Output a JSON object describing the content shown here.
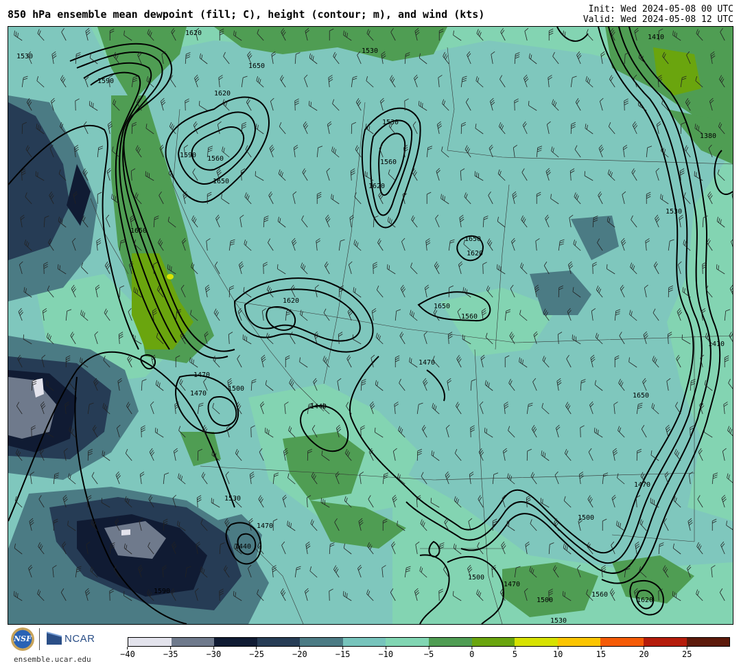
{
  "header": {
    "title": "850 hPa ensemble mean dewpoint (fill; C), height (contour; m), and wind (kts)",
    "init": "Init: Wed 2024-05-08 00 UTC",
    "valid": "Valid: Wed 2024-05-08 12 UTC"
  },
  "map": {
    "fill_levels": [
      -40,
      -35,
      -30,
      -25,
      -20,
      -15,
      -10,
      -5,
      0,
      5,
      10,
      15,
      20,
      25
    ],
    "contour_labels": [
      "1530",
      "1620",
      "1650",
      "1590",
      "1620",
      "1560",
      "1650",
      "1530",
      "1560",
      "1620",
      "1650",
      "1620",
      "1650",
      "1560",
      "1620",
      "1590",
      "1530",
      "1410",
      "1380",
      "1530",
      "1410",
      "1650",
      "1470",
      "1440",
      "1470",
      "1500",
      "1530",
      "1470",
      "1440",
      "1500",
      "1470",
      "1500",
      "1530",
      "1560",
      "1620",
      "1590",
      "1650",
      "1470",
      "1500",
      "1470"
    ]
  },
  "colorbar": {
    "colors": [
      "#e3e3ec",
      "#6f7a8c",
      "#101b33",
      "#263c55",
      "#4b7b84",
      "#77c4bc",
      "#81d6b3",
      "#4f9d53",
      "#6aa50e",
      "#d7e200",
      "#fbc500",
      "#f55b06",
      "#b51c0b",
      "#5c1a0b"
    ],
    "tick_labels": [
      "−40",
      "−35",
      "−30",
      "−25",
      "−20",
      "−15",
      "−10",
      "−5",
      "0",
      "5",
      "10",
      "15",
      "20",
      "25"
    ]
  },
  "footer": {
    "nsf_label": "NSF",
    "ncar_label": "NCAR",
    "site": "ensemble.ucar.edu"
  }
}
